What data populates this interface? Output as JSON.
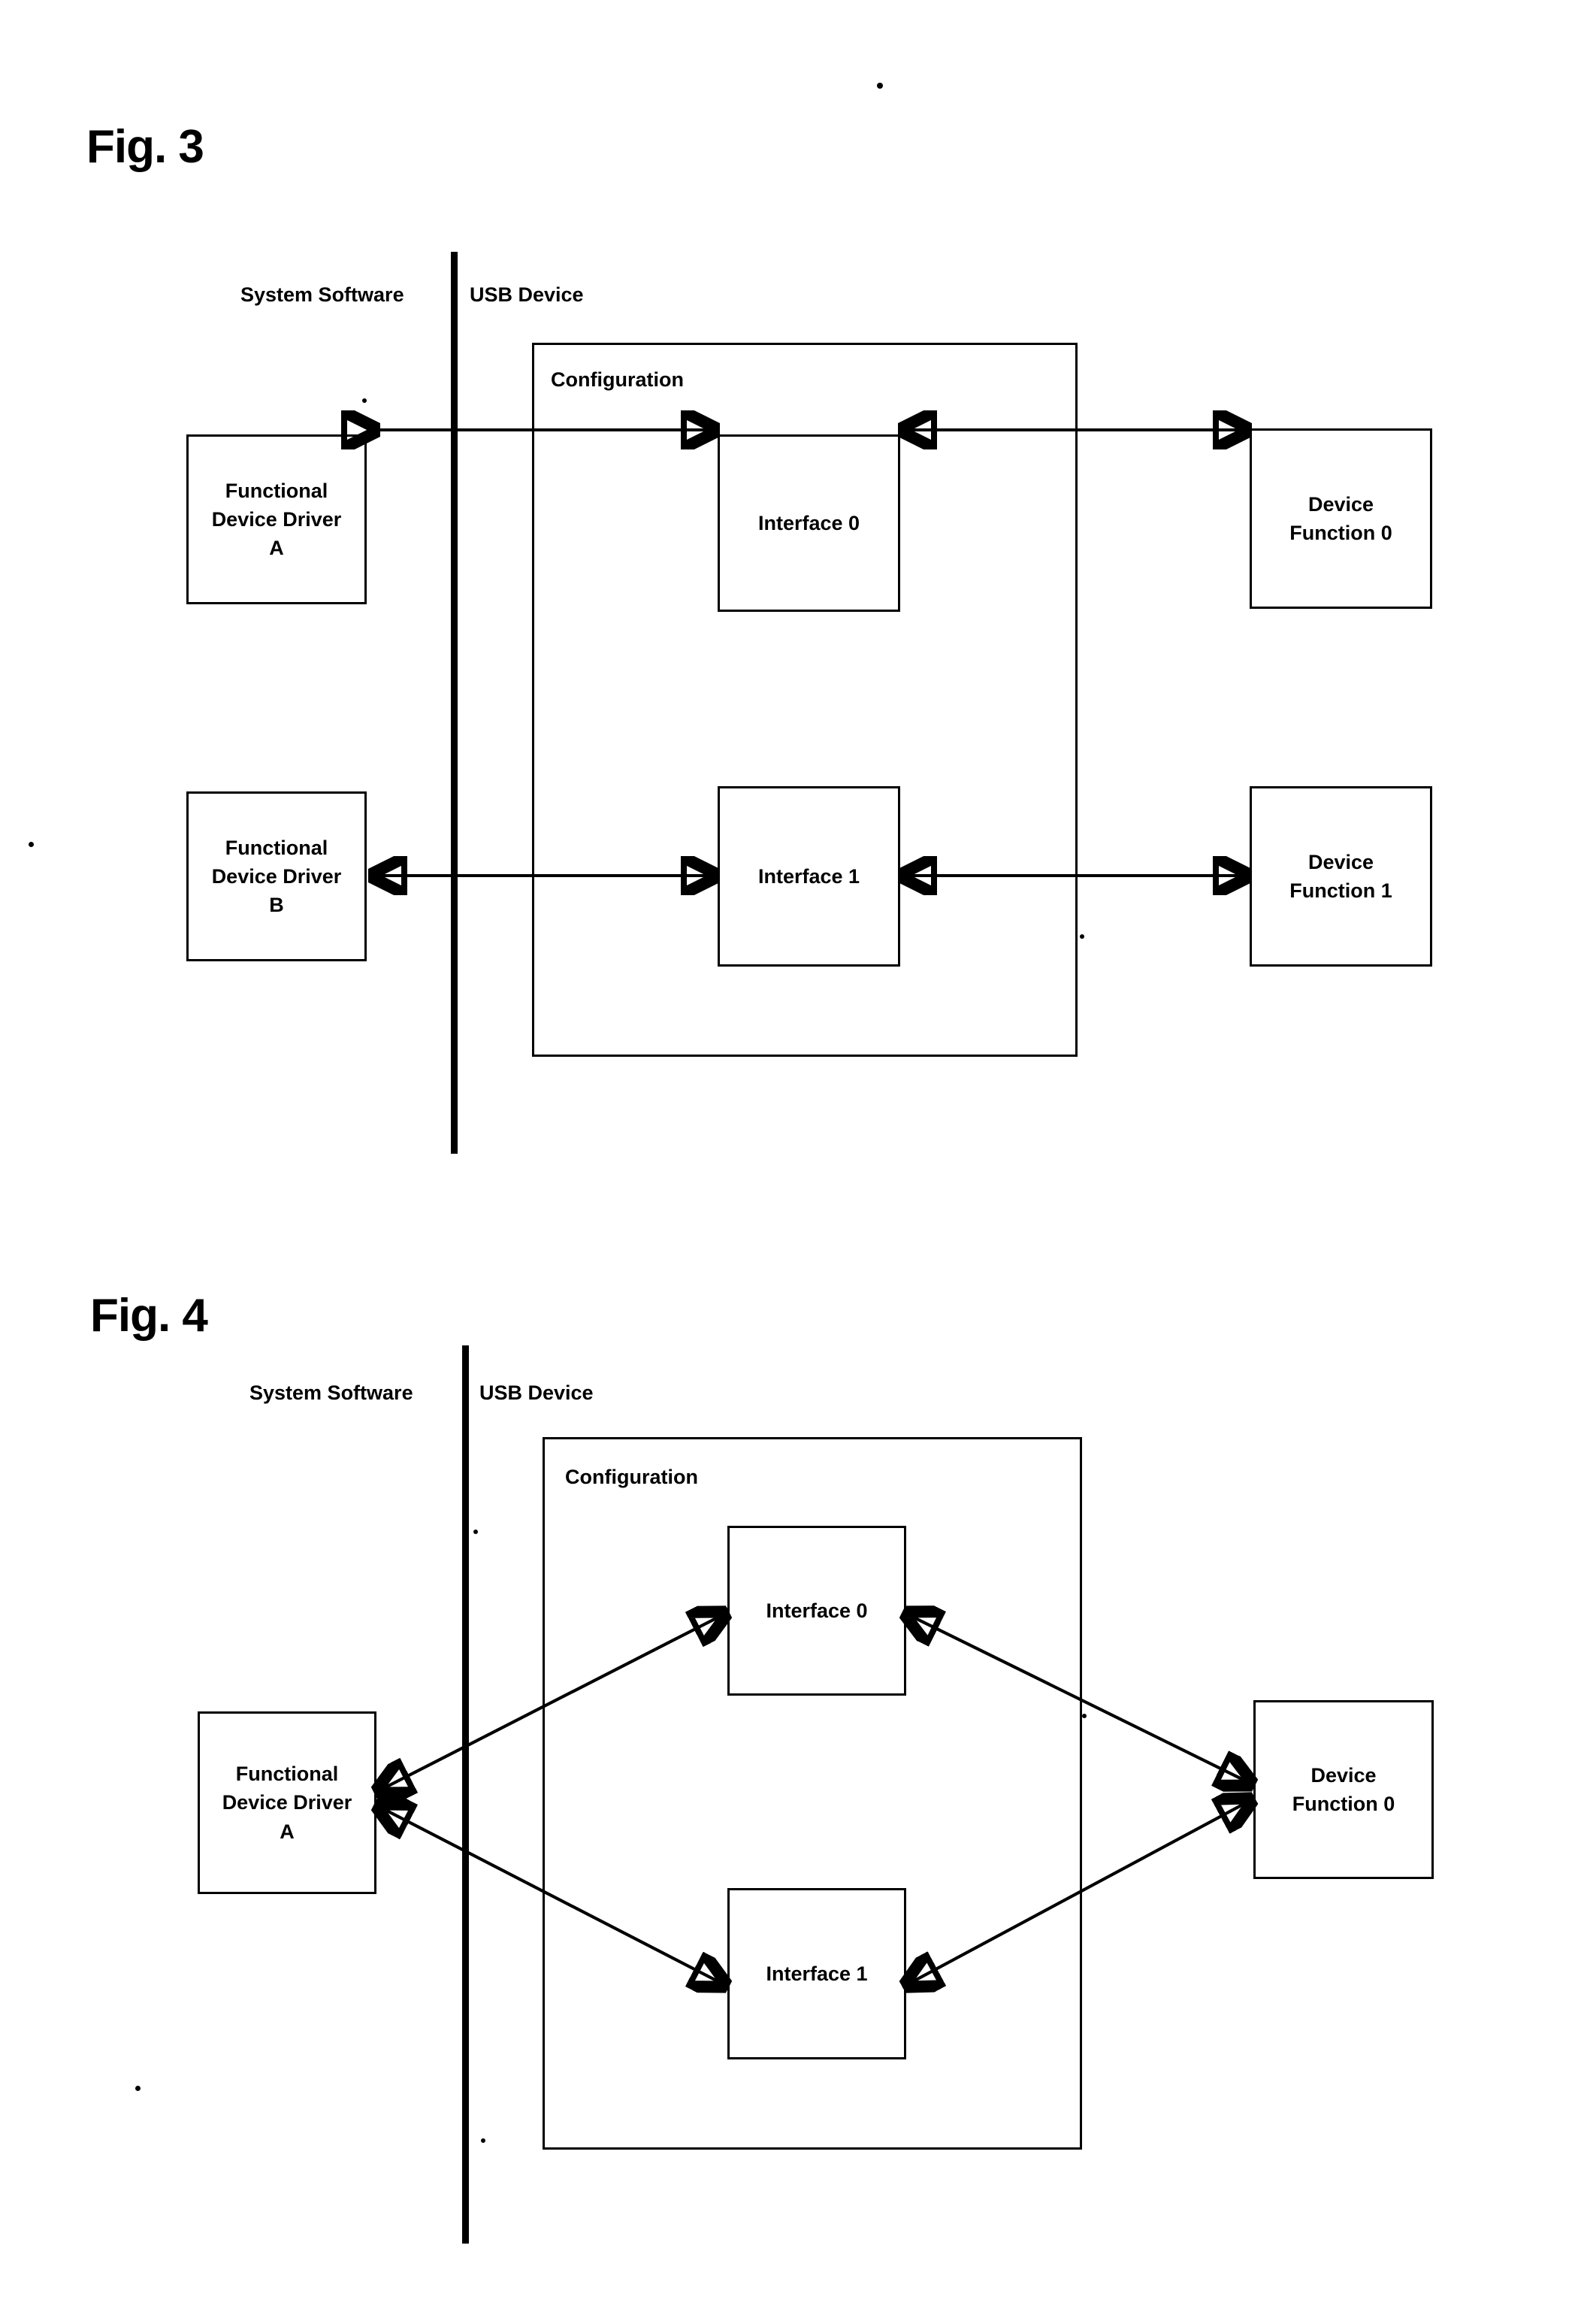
{
  "figures": [
    {
      "id": "fig3",
      "title": "Fig. 3",
      "left_side_label": "System Software",
      "right_side_label": "USB Device",
      "config_label": "Configuration",
      "boxes": [
        {
          "name": "functional-device-driver-a",
          "label": "Functional\nDevice Driver\nA"
        },
        {
          "name": "functional-device-driver-b",
          "label": "Functional\nDevice Driver\nB"
        },
        {
          "name": "interface-0",
          "label": "Interface 0"
        },
        {
          "name": "interface-1",
          "label": "Interface 1"
        },
        {
          "name": "device-function-0",
          "label": "Device\nFunction 0"
        },
        {
          "name": "device-function-1",
          "label": "Device\nFunction 1"
        }
      ]
    },
    {
      "id": "fig4",
      "title": "Fig. 4",
      "left_side_label": "System Software",
      "right_side_label": "USB Device",
      "config_label": "Configuration",
      "boxes": [
        {
          "name": "functional-device-driver-a",
          "label": "Functional\nDevice Driver\nA"
        },
        {
          "name": "interface-0",
          "label": "Interface 0"
        },
        {
          "name": "interface-1",
          "label": "Interface 1"
        },
        {
          "name": "device-function-0",
          "label": "Device\nFunction 0"
        }
      ]
    }
  ],
  "colors": {
    "ink": "#000000",
    "paper": "#ffffff"
  }
}
